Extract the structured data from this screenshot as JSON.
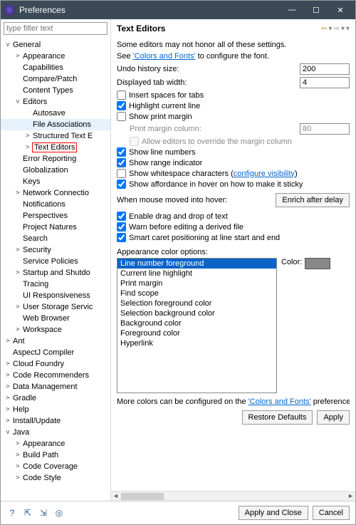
{
  "title": "Preferences",
  "filterPlaceholder": "type filter text",
  "tree": [
    {
      "d": 1,
      "tw": "v",
      "label": "General"
    },
    {
      "d": 2,
      "tw": ">",
      "label": "Appearance"
    },
    {
      "d": 2,
      "tw": "",
      "label": "Capabilities"
    },
    {
      "d": 2,
      "tw": "",
      "label": "Compare/Patch"
    },
    {
      "d": 2,
      "tw": "",
      "label": "Content Types"
    },
    {
      "d": 2,
      "tw": "v",
      "label": "Editors"
    },
    {
      "d": 3,
      "tw": "",
      "label": "Autosave"
    },
    {
      "d": 3,
      "tw": "",
      "label": "File Associations",
      "bg": true
    },
    {
      "d": 3,
      "tw": ">",
      "label": "Structured Text E"
    },
    {
      "d": 3,
      "tw": ">",
      "label": "Text Editors",
      "sel": true
    },
    {
      "d": 2,
      "tw": "",
      "label": "Error Reporting"
    },
    {
      "d": 2,
      "tw": "",
      "label": "Globalization"
    },
    {
      "d": 2,
      "tw": "",
      "label": "Keys"
    },
    {
      "d": 2,
      "tw": ">",
      "label": "Network Connectio"
    },
    {
      "d": 2,
      "tw": "",
      "label": "Notifications"
    },
    {
      "d": 2,
      "tw": "",
      "label": "Perspectives"
    },
    {
      "d": 2,
      "tw": "",
      "label": "Project Natures"
    },
    {
      "d": 2,
      "tw": "",
      "label": "Search"
    },
    {
      "d": 2,
      "tw": ">",
      "label": "Security"
    },
    {
      "d": 2,
      "tw": "",
      "label": "Service Policies"
    },
    {
      "d": 2,
      "tw": ">",
      "label": "Startup and Shutdo"
    },
    {
      "d": 2,
      "tw": "",
      "label": "Tracing"
    },
    {
      "d": 2,
      "tw": "",
      "label": "UI Responsiveness"
    },
    {
      "d": 2,
      "tw": ">",
      "label": "User Storage Servic"
    },
    {
      "d": 2,
      "tw": "",
      "label": "Web Browser"
    },
    {
      "d": 2,
      "tw": ">",
      "label": "Workspace"
    },
    {
      "d": 1,
      "tw": ">",
      "label": "Ant"
    },
    {
      "d": 1,
      "tw": "",
      "label": "AspectJ Compiler"
    },
    {
      "d": 1,
      "tw": ">",
      "label": "Cloud Foundry"
    },
    {
      "d": 1,
      "tw": ">",
      "label": "Code Recommenders"
    },
    {
      "d": 1,
      "tw": ">",
      "label": "Data Management"
    },
    {
      "d": 1,
      "tw": ">",
      "label": "Gradle"
    },
    {
      "d": 1,
      "tw": ">",
      "label": "Help"
    },
    {
      "d": 1,
      "tw": ">",
      "label": "Install/Update"
    },
    {
      "d": 1,
      "tw": "v",
      "label": "Java"
    },
    {
      "d": 2,
      "tw": ">",
      "label": "Appearance"
    },
    {
      "d": 2,
      "tw": ">",
      "label": "Build Path"
    },
    {
      "d": 2,
      "tw": ">",
      "label": "Code Coverage"
    },
    {
      "d": 2,
      "tw": ">",
      "label": "Code Style"
    }
  ],
  "page": {
    "heading": "Text Editors",
    "note1": "Some editors may not honor all of these settings.",
    "note2a": "See ",
    "note2link": "'Colors and Fonts'",
    "note2b": " to configure the font.",
    "undoLabel": "Undo history size:",
    "undoVal": "200",
    "tabLabel": "Displayed tab width:",
    "tabVal": "4",
    "cbSpaces": "Insert spaces for tabs",
    "cbHilite": "Highlight current line",
    "cbMargin": "Show print margin",
    "marginColLabel": "Print margin column:",
    "marginColVal": "80",
    "cbOverride": "Allow editors to override the margin column",
    "cbLineNum": "Show line numbers",
    "cbRange": "Show range indicator",
    "cbWhite": "Show whitespace characters (",
    "cbWhiteLink": "configure visibility",
    "cbWhiteEnd": ")",
    "cbAfford": "Show affordance in hover on how to make it sticky",
    "hoverLabel": "When mouse moved into hover:",
    "hoverBtn": "Enrich after delay",
    "cbDrag": "Enable drag and drop of text",
    "cbWarn": "Warn before editing a derived file",
    "cbSmart": "Smart caret positioning at line start and end",
    "acoLabel": "Appearance color options:",
    "colorLabel": "Color:",
    "options": [
      "Line number foreground",
      "Current line highlight",
      "Print margin",
      "Find scope",
      "Selection foreground color",
      "Selection background color",
      "Background color",
      "Foreground color",
      "Hyperlink"
    ],
    "more1": "More colors can be configured on the ",
    "moreLink": "'Colors and Fonts'",
    "more2": " preference pa",
    "restore": "Restore Defaults",
    "apply": "Apply"
  },
  "footer": {
    "applyClose": "Apply and Close",
    "cancel": "Cancel"
  }
}
